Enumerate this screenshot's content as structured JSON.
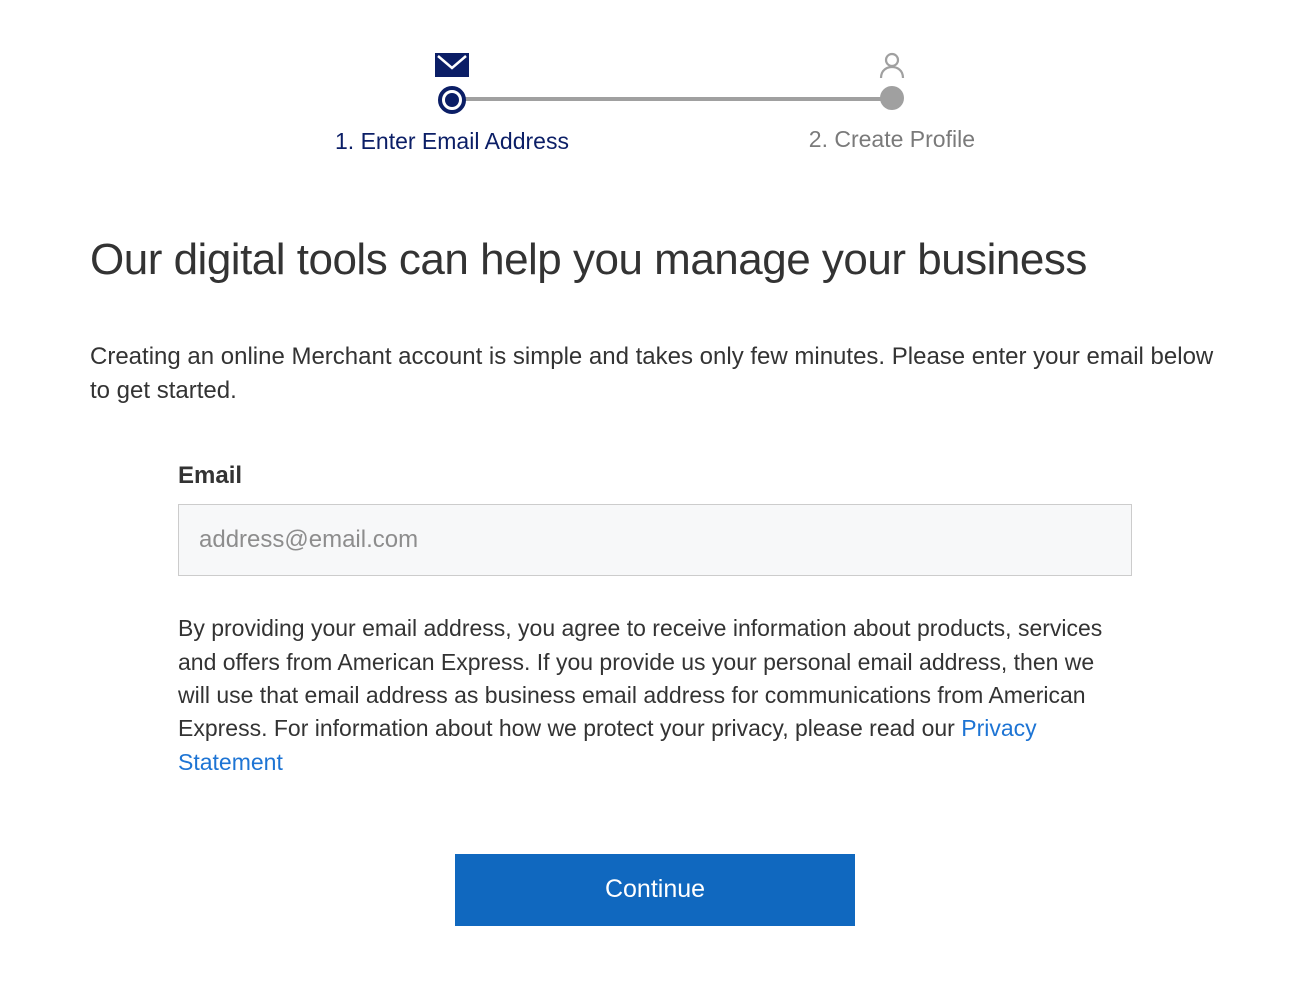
{
  "stepper": {
    "steps": [
      {
        "label": "1. Enter Email Address",
        "active": true
      },
      {
        "label": "2. Create Profile",
        "active": false
      }
    ]
  },
  "heading": "Our digital tools can help you manage your business",
  "subtext": "Creating an online Merchant account is simple and takes only few minutes. Please enter your email below to get started.",
  "form": {
    "email_label": "Email",
    "email_placeholder": "address@email.com",
    "email_value": ""
  },
  "disclaimer": {
    "text_before_link": "By providing your email address, you agree to receive information about products, services and offers from American Express. If you provide us your personal email address, then we will use that email address as business email address for communications from American Express. For information about how we protect your privacy, please read our ",
    "link_text": "Privacy Statement"
  },
  "actions": {
    "continue_label": "Continue"
  },
  "colors": {
    "brand_dark": "#0b1e66",
    "button_blue": "#1068bf",
    "link_blue": "#1d74d4",
    "inactive_grey": "#a0a0a0"
  }
}
